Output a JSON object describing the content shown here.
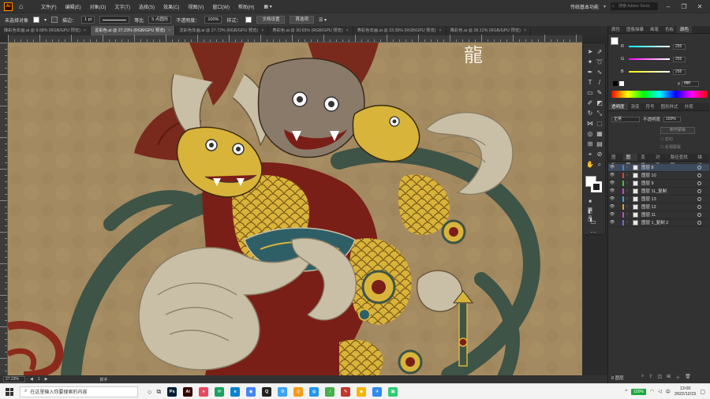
{
  "app": {
    "logo": "Ai",
    "menus": [
      "文件(F)",
      "编辑(E)",
      "对象(O)",
      "文字(T)",
      "选择(S)",
      "效果(C)",
      "视图(V)",
      "窗口(W)",
      "帮助(H)"
    ],
    "workspace": "传统基本功能",
    "search_placeholder": "搜索 Adobe Stock"
  },
  "control_bar": {
    "selection_label": "未选择对象",
    "stroke_label": "描边：",
    "stroke_weight": "1 pt",
    "stroke_style": "等比",
    "brush": "5 点圆形",
    "opacity_label": "不透明度：",
    "opacity_value": "100%",
    "style_label": "样式：",
    "doc_setup": "文档设置",
    "preferences": "首选项"
  },
  "tabs": [
    {
      "label": "降彩色年画.ai @ 9.68% (RGB/GPU 预览)",
      "active": false
    },
    {
      "label": "龙彩色.ai @ 27.23% (RGB/GPU 预览)",
      "active": true
    },
    {
      "label": "龙彩色年画.ai @ 27.72% (RGB/GPU 预览)",
      "active": false
    },
    {
      "label": "寿彩色.ai @ 30.65% (RGB/GPU 预览)",
      "active": false
    },
    {
      "label": "寿彩色年画.ai @ 23.39% (RGB/GPU 预览)",
      "active": false
    },
    {
      "label": "降彩色.ai @ 28.12% (RGB/GPU 预览)",
      "active": false
    }
  ],
  "canvas": {
    "title_char": "龍",
    "colors": {
      "bg": "#a48a60",
      "red": "#7a1f18",
      "green": "#3d5447",
      "gold": "#d9b43a",
      "cream": "#c9bfa6"
    }
  },
  "status": {
    "zoom": "27.23%",
    "page": "1",
    "mode": "抓手"
  },
  "panels": {
    "top_tabs": [
      "属性",
      "图像描摹",
      "画笔",
      "色板",
      "颜色"
    ],
    "color_channels": [
      {
        "ch": "R",
        "value": "255"
      },
      {
        "ch": "G",
        "value": "255"
      },
      {
        "ch": "B",
        "value": "255"
      }
    ],
    "hex": "ffffff",
    "transparency_tabs": [
      "透明度",
      "渐变",
      "符号",
      "图形样式",
      "外观"
    ],
    "blend_mode": "正常",
    "opacity_label": "不透明度",
    "opacity_value": "100%",
    "mask_button": "制作蒙版",
    "clip_label": "剪切",
    "invert_label": "反相蒙版",
    "layer_tabs": [
      "图板",
      "图层",
      "变换",
      "对齐",
      "路径查找器",
      "描边"
    ],
    "layers": [
      {
        "name": "图层 8",
        "color": "#4f7bd1",
        "selected": true
      },
      {
        "name": "图层 10",
        "color": "#e04040",
        "selected": false
      },
      {
        "name": "图层 9",
        "color": "#40c040",
        "selected": false
      },
      {
        "name": "图层 11_复制",
        "color": "#c04ad0",
        "selected": false
      },
      {
        "name": "图层 13",
        "color": "#40a0e0",
        "selected": false
      },
      {
        "name": "图层 12",
        "color": "#e0a040",
        "selected": false
      },
      {
        "name": "图层 11",
        "color": "#c04ad0",
        "selected": false
      },
      {
        "name": "图层 1_复制 2",
        "color": "#8060e0",
        "selected": false
      }
    ],
    "layer_count": "8 图层"
  },
  "taskbar": {
    "search_text": "在这里输入你要搜索的内容",
    "apps": [
      {
        "label": "Ps",
        "color": "#001e36"
      },
      {
        "label": "Ai",
        "color": "#330000"
      },
      {
        "label": "●",
        "color": "#e84a5f"
      },
      {
        "label": "✉",
        "color": "#1aa260"
      },
      {
        "label": "e",
        "color": "#0a84d0"
      },
      {
        "label": "◉",
        "color": "#4285f4"
      },
      {
        "label": "Q",
        "color": "#222"
      },
      {
        "label": "⚙",
        "color": "#3da5f4"
      },
      {
        "label": "◎",
        "color": "#f49c1a"
      },
      {
        "label": "◍",
        "color": "#2196f3"
      },
      {
        "label": "♪",
        "color": "#46b04a"
      },
      {
        "label": "✎",
        "color": "#c0392b"
      },
      {
        "label": "◆",
        "color": "#f7b500"
      },
      {
        "label": "✈",
        "color": "#2d8cf0"
      },
      {
        "label": "▣",
        "color": "#2ecc71"
      }
    ],
    "battery": "100%",
    "time": "13:00",
    "date": "2022/12/15"
  }
}
